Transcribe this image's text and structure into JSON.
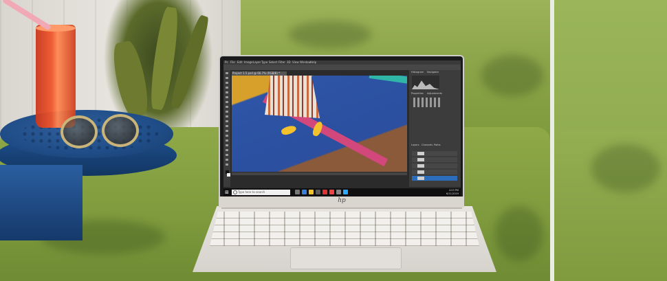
{
  "scene": {
    "description_tags": [
      "laptop",
      "patio-cushion",
      "table",
      "drink-glass",
      "sunglasses",
      "plant"
    ]
  },
  "laptop": {
    "brand_logo": "hp",
    "screen": {
      "app": "Photoshop",
      "menu": [
        "Ps",
        "File",
        "Edit",
        "Image",
        "Layer",
        "Type",
        "Select",
        "Filter",
        "3D",
        "View",
        "Window",
        "Help"
      ],
      "document_tab": "Project 1.5.psd @ 66.7% (RGB/8) *",
      "panels": {
        "top_tabs": [
          "Histogram",
          "Navigator"
        ],
        "middle_tabs": [
          "Properties",
          "Adjustments"
        ],
        "bottom_tabs": [
          "Layers",
          "Channels",
          "Paths"
        ],
        "layers": [
          "Layer 4",
          "Color Fill 1",
          "Layer 3",
          "Layer 2",
          "Background"
        ]
      },
      "taskbar": {
        "search_placeholder": "Type here to search",
        "tray_time": "4:03 PM",
        "tray_date": "6/11/2019"
      }
    }
  }
}
